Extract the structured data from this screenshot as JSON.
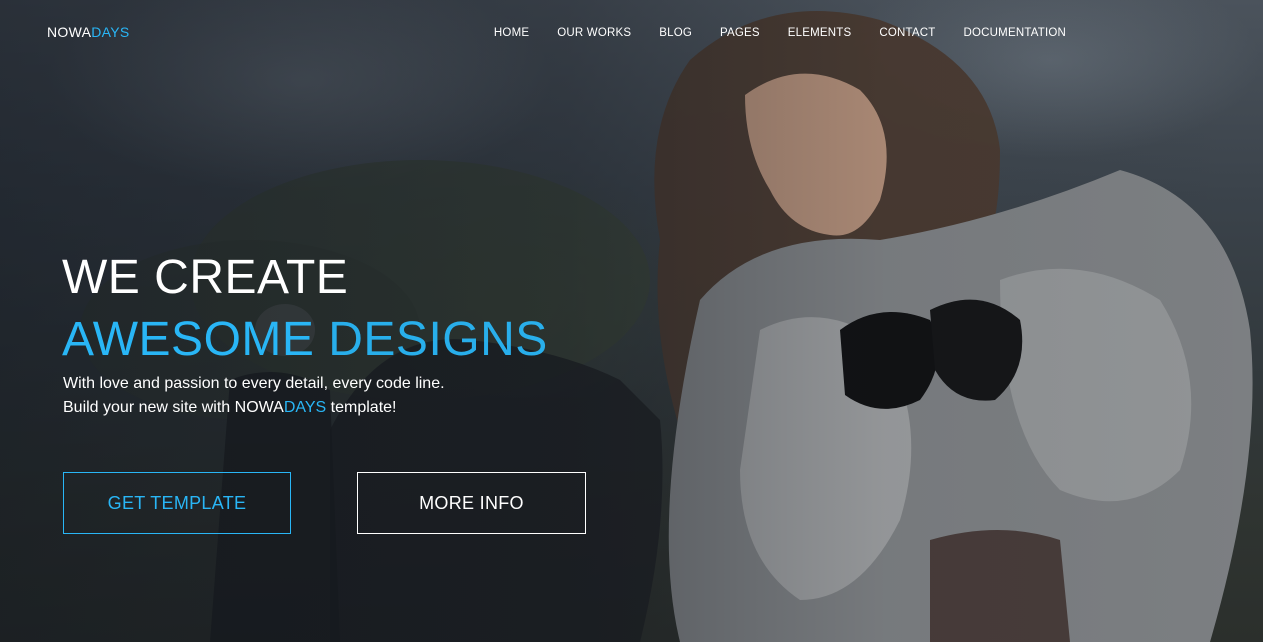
{
  "header": {
    "logo_main": "NOWA",
    "logo_accent": "DAYS",
    "nav": [
      "HOME",
      "OUR WORKS",
      "BLOG",
      "PAGES",
      "ELEMENTS",
      "CONTACT",
      "DOCUMENTATION"
    ]
  },
  "hero": {
    "line1": "WE CREATE",
    "line2_strong": "AWESOME",
    "line2_light": "DESIGNS",
    "lead_line1": "With love and passion to every detail, every code line.",
    "lead_line2_before": "Build your new site with ",
    "lead_line2_brand_main": "NOWA",
    "lead_line2_brand_accent": "DAYS",
    "lead_line2_after": " template!",
    "primary_button": "GET TEMPLATE",
    "secondary_button": "MORE INFO"
  },
  "colors": {
    "accent": "#29b6f6",
    "text": "#ffffff"
  }
}
